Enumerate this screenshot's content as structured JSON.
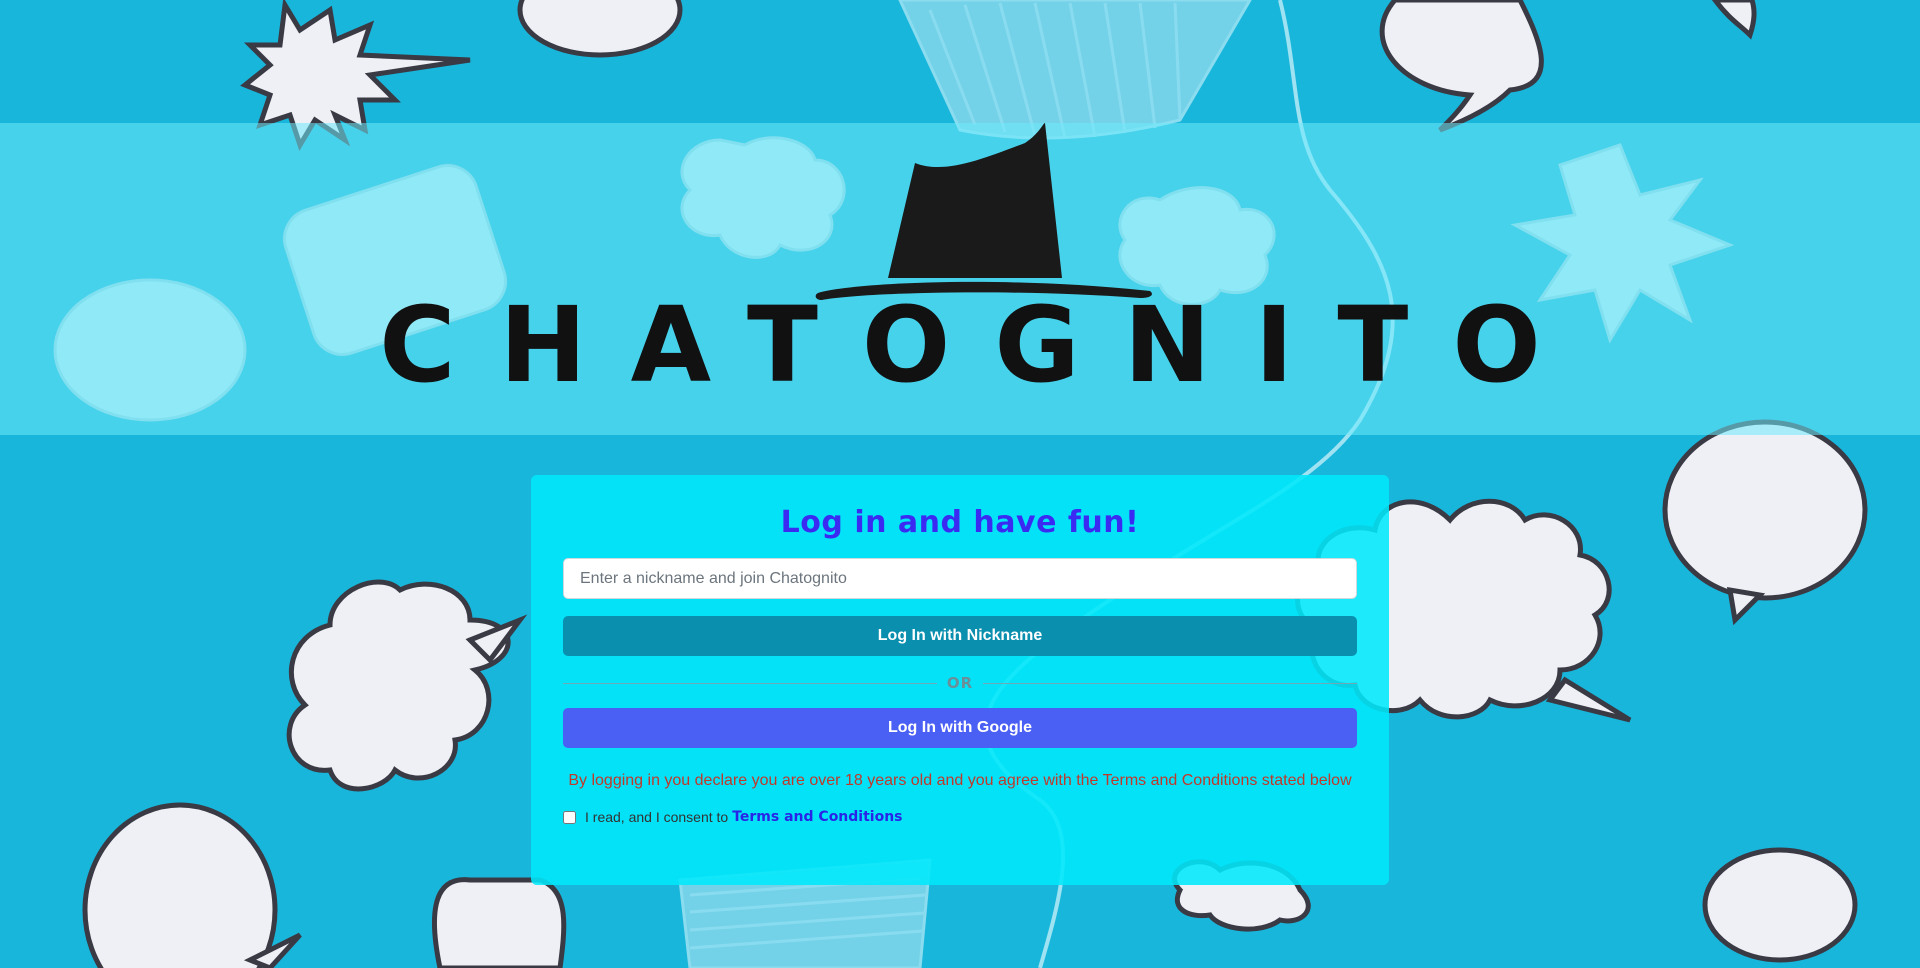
{
  "app": {
    "brand_name": "CHATOGNITO"
  },
  "login_card": {
    "title": "Log in and have fun!",
    "nickname_placeholder": "Enter a nickname and join Chatognito",
    "nickname_value": "",
    "nickname_button_label": "Log In with Nickname",
    "divider_label": "OR",
    "google_button_label": "Log In with Google",
    "disclaimer": "By logging in you declare you are over 18 years old and you agree with the Terms and Conditions stated below",
    "consent_text": "I read, and I consent to",
    "terms_link_label": "Terms and Conditions",
    "consent_checked": false
  },
  "colors": {
    "background": "#19b6dc",
    "card": "#00e8fa",
    "title": "#3b2bf2",
    "nickname_button": "#0a8fae",
    "google_button": "#4a5ff3",
    "disclaimer": "#c0392b",
    "terms_link": "#2a25e6"
  },
  "icons": [
    "hat-logo-icon",
    "speech-bubble-icon",
    "plastic-cup-icon"
  ]
}
